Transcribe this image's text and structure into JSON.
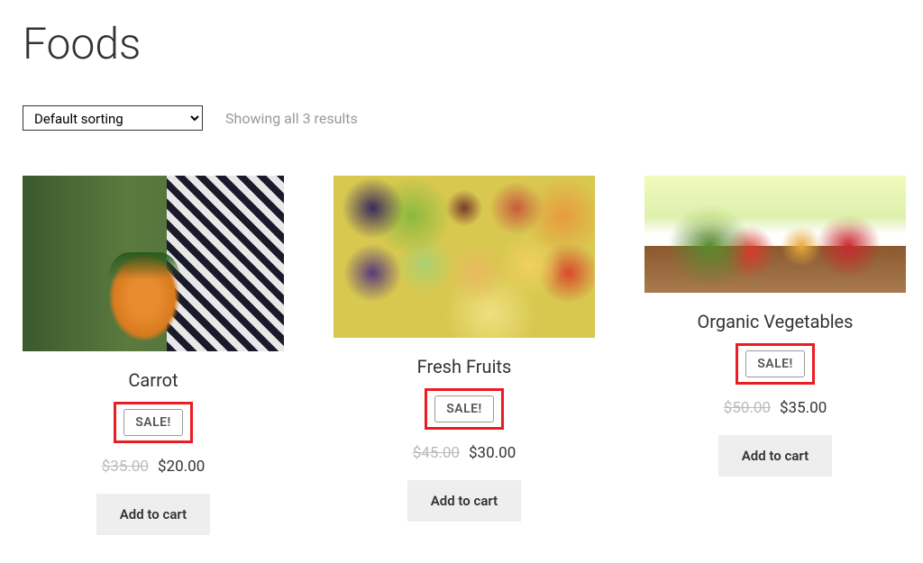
{
  "page": {
    "title": "Foods",
    "sort_selected": "Default sorting",
    "result_count": "Showing all 3 results"
  },
  "products": [
    {
      "name": "Carrot",
      "sale_label": "SALE!",
      "old_price": "$35.00",
      "price": "$20.00",
      "add_label": "Add to cart"
    },
    {
      "name": "Fresh Fruits",
      "sale_label": "SALE!",
      "old_price": "$45.00",
      "price": "$30.00",
      "add_label": "Add to cart"
    },
    {
      "name": "Organic Vegetables",
      "sale_label": "SALE!",
      "old_price": "$50.00",
      "price": "$35.00",
      "add_label": "Add to cart"
    }
  ]
}
